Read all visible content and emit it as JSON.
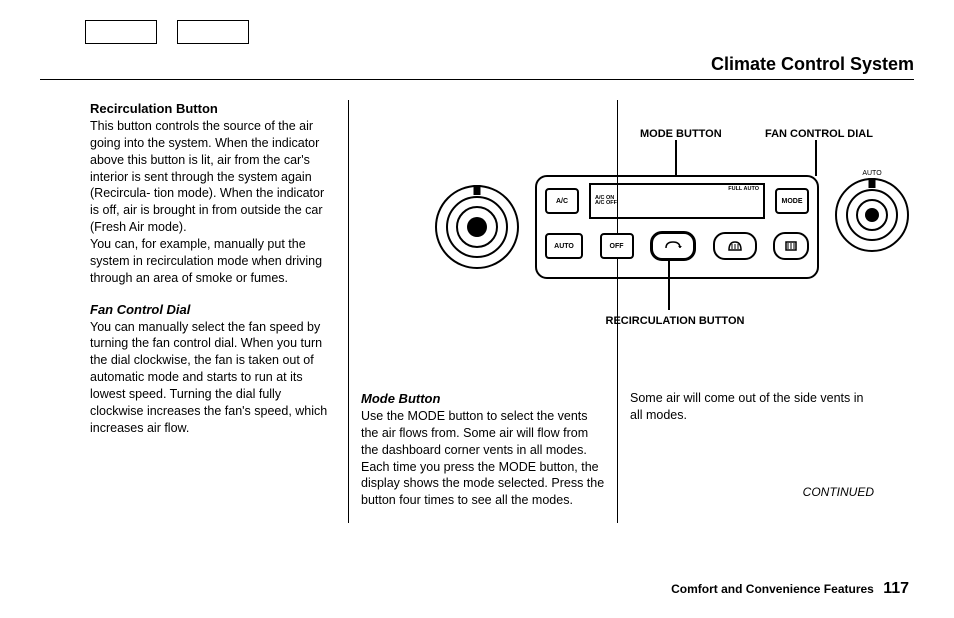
{
  "page_title": "Climate Control System",
  "column1": {
    "heading1": "Recirculation Button",
    "para1": "This button controls the source of the air going into the system. When the indicator above this button is lit, air from the car's interior is sent through the system again (Recircula- tion mode). When the indicator is off, air is brought in from outside the car (Fresh Air mode).",
    "para1b": "You can, for example, manually put the system in recirculation mode when driving through an area of smoke or fumes.",
    "heading2": "Fan Control Dial",
    "para2": "You can manually select the fan speed by turning the fan control dial. When you turn the dial clockwise, the fan is taken out of automatic mode and starts to run at its lowest speed. Turning the dial fully clockwise increases the fan's speed, which increases air flow."
  },
  "column2": {
    "heading": "Mode Button",
    "para": "Use the MODE button to select the vents the air flows from. Some air will flow from the dashboard corner vents in all modes. Each time you press the MODE button, the display shows the mode selected. Press the button four times to see all the modes."
  },
  "column3": {
    "para": "Some air will come out of the side vents in all modes.",
    "continued": "CONTINUED"
  },
  "diagram": {
    "label_mode": "MODE BUTTON",
    "label_fan": "FAN CONTROL DIAL",
    "label_recirc": "RECIRCULATION BUTTON",
    "btn_ac": "A/C",
    "btn_mode": "MODE",
    "btn_auto": "AUTO",
    "btn_off": "OFF",
    "display_line1": "A/C ON",
    "display_line2": "A/C OFF",
    "display_right": "FULL AUTO",
    "fan_arc": "AUTO"
  },
  "footer": {
    "section": "Comfort and Convenience Features",
    "page": "117"
  }
}
